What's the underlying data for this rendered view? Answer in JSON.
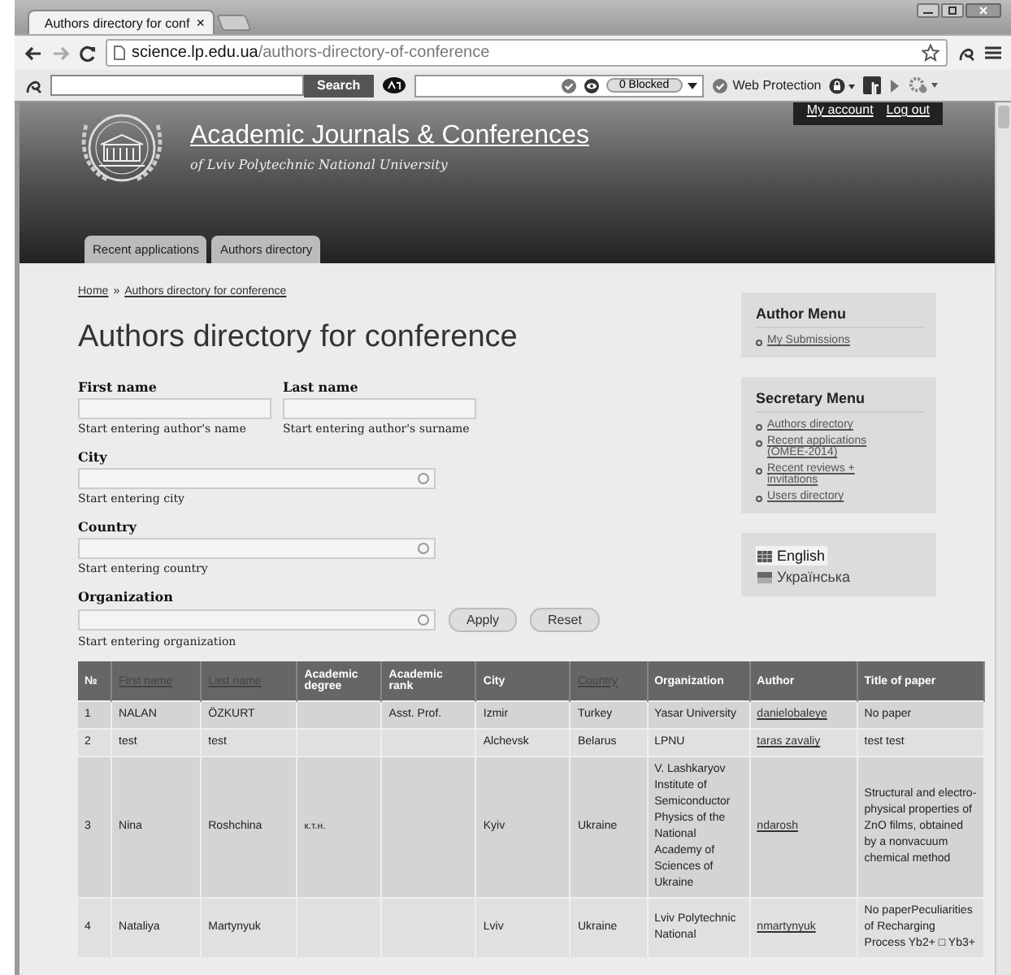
{
  "browser": {
    "tab_title": "Authors directory for conf",
    "tab_close": "×",
    "url_host": "science.lp.edu.ua",
    "url_path": "/authors-directory-of-conference",
    "search_button": "Search",
    "blocked": "0 Blocked",
    "web_protection": "Web Protection"
  },
  "site": {
    "title": "Academic Journals & Conferences",
    "subtitle": "of Lviv Polytechnic National University",
    "account_links": [
      "My account",
      "Log out"
    ],
    "tabs": [
      "Recent applications",
      "Authors directory"
    ]
  },
  "breadcrumb": {
    "items": [
      "Home",
      "Authors directory for conference"
    ],
    "separator": "»"
  },
  "page_title": "Authors directory for conference",
  "filters": [
    {
      "label": "First name",
      "description": "Start entering author's name",
      "kind": "text"
    },
    {
      "label": "Last name",
      "description": "Start entering author's surname",
      "kind": "text"
    },
    {
      "label": "City",
      "description": "Start entering city",
      "kind": "autocomplete"
    },
    {
      "label": "Country",
      "description": "Start entering country",
      "kind": "autocomplete"
    },
    {
      "label": "Organization",
      "description": "Start entering organization",
      "kind": "autocomplete"
    }
  ],
  "buttons": [
    "Apply",
    "Reset"
  ],
  "sidebar": [
    {
      "title": "Author Menu",
      "links": [
        "My Submissions"
      ]
    },
    {
      "title": "Secretary Menu",
      "links": [
        "Authors directory",
        "Recent applications (OMEE-2014)",
        "Recent reviews + invitations",
        "Users directory"
      ]
    }
  ],
  "languages": [
    {
      "label": "English",
      "selected": true
    },
    {
      "label": "Українська",
      "selected": false
    }
  ],
  "table": {
    "columns": [
      {
        "label": "№",
        "sortable": false,
        "kind": "text"
      },
      {
        "label": "First name",
        "sortable": true,
        "kind": "text"
      },
      {
        "label": "Last name",
        "sortable": true,
        "kind": "text"
      },
      {
        "label": "Academic degree",
        "sortable": false,
        "kind": "text"
      },
      {
        "label": "Academic rank",
        "sortable": false,
        "kind": "text"
      },
      {
        "label": "City",
        "sortable": false,
        "kind": "text"
      },
      {
        "label": "Country",
        "sortable": true,
        "kind": "text"
      },
      {
        "label": "Organization",
        "sortable": false,
        "kind": "text"
      },
      {
        "label": "Author",
        "sortable": false,
        "kind": "link"
      },
      {
        "label": "Title of paper",
        "sortable": false,
        "kind": "text"
      }
    ],
    "rows": [
      [
        "1",
        "NALAN",
        "ÖZKURT",
        "",
        "Asst. Prof.",
        "Izmir",
        "Turkey",
        "Yasar University",
        "danielobaleye",
        "No paper"
      ],
      [
        "2",
        "test",
        "test",
        "",
        "",
        "Alchevsk",
        "Belarus",
        "LPNU",
        "taras zavaliy",
        "test test"
      ],
      [
        "3",
        "Nina",
        "Roshchina",
        "к.т.н.",
        "",
        "Kyiv",
        "Ukraine",
        "V. Lashkaryov Institute of Semiconductor Physics of the National Academy of Sciences of Ukraine",
        "ndarosh",
        "Structural and electro-physical properties of ZnO films, obtained by a nonvacuum chemical method"
      ],
      [
        "4",
        "Nataliya",
        "Martynyuk",
        "",
        "",
        "Lviv",
        "Ukraine",
        "Lviv Polytechnic National",
        "nmartynyuk",
        "No paperPeculiarities of Recharging Process Yb2+ □ Yb3+"
      ]
    ]
  }
}
